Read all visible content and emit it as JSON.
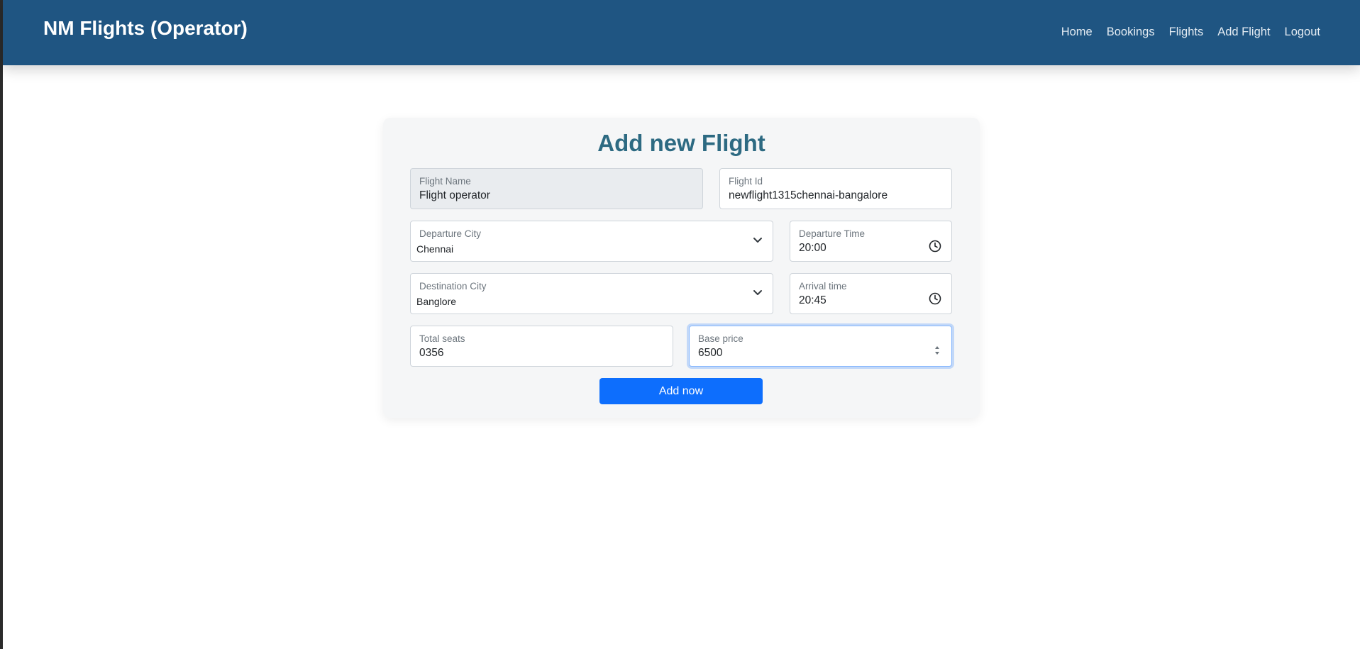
{
  "navbar": {
    "brand": "NM Flights (Operator)",
    "links": [
      "Home",
      "Bookings",
      "Flights",
      "Add Flight",
      "Logout"
    ],
    "background_color": "#1f5582"
  },
  "form": {
    "title": "Add new Flight",
    "flight_name": {
      "label": "Flight Name",
      "value": "Flight operator",
      "disabled": true
    },
    "flight_id": {
      "label": "Flight Id",
      "value": "newflight1315chennai-bangalore"
    },
    "departure_city": {
      "label": "Departure City",
      "value": "Chennai",
      "icon": "chevron-down-icon"
    },
    "departure_time": {
      "label": "Departure Time",
      "value": "20:00",
      "icon": "clock-icon"
    },
    "destination_city": {
      "label": "Destination City",
      "value": "Banglore",
      "icon": "chevron-down-icon"
    },
    "arrival_time": {
      "label": "Arrival time",
      "value": "20:45",
      "icon": "clock-icon"
    },
    "total_seats": {
      "label": "Total seats",
      "value": "0356"
    },
    "base_price": {
      "label": "Base price",
      "value": "6500",
      "focused": true,
      "icon": "number-spinner-icon"
    },
    "submit_label": "Add now",
    "accent_color": "#0d6efd",
    "title_color": "#2d6a82"
  }
}
